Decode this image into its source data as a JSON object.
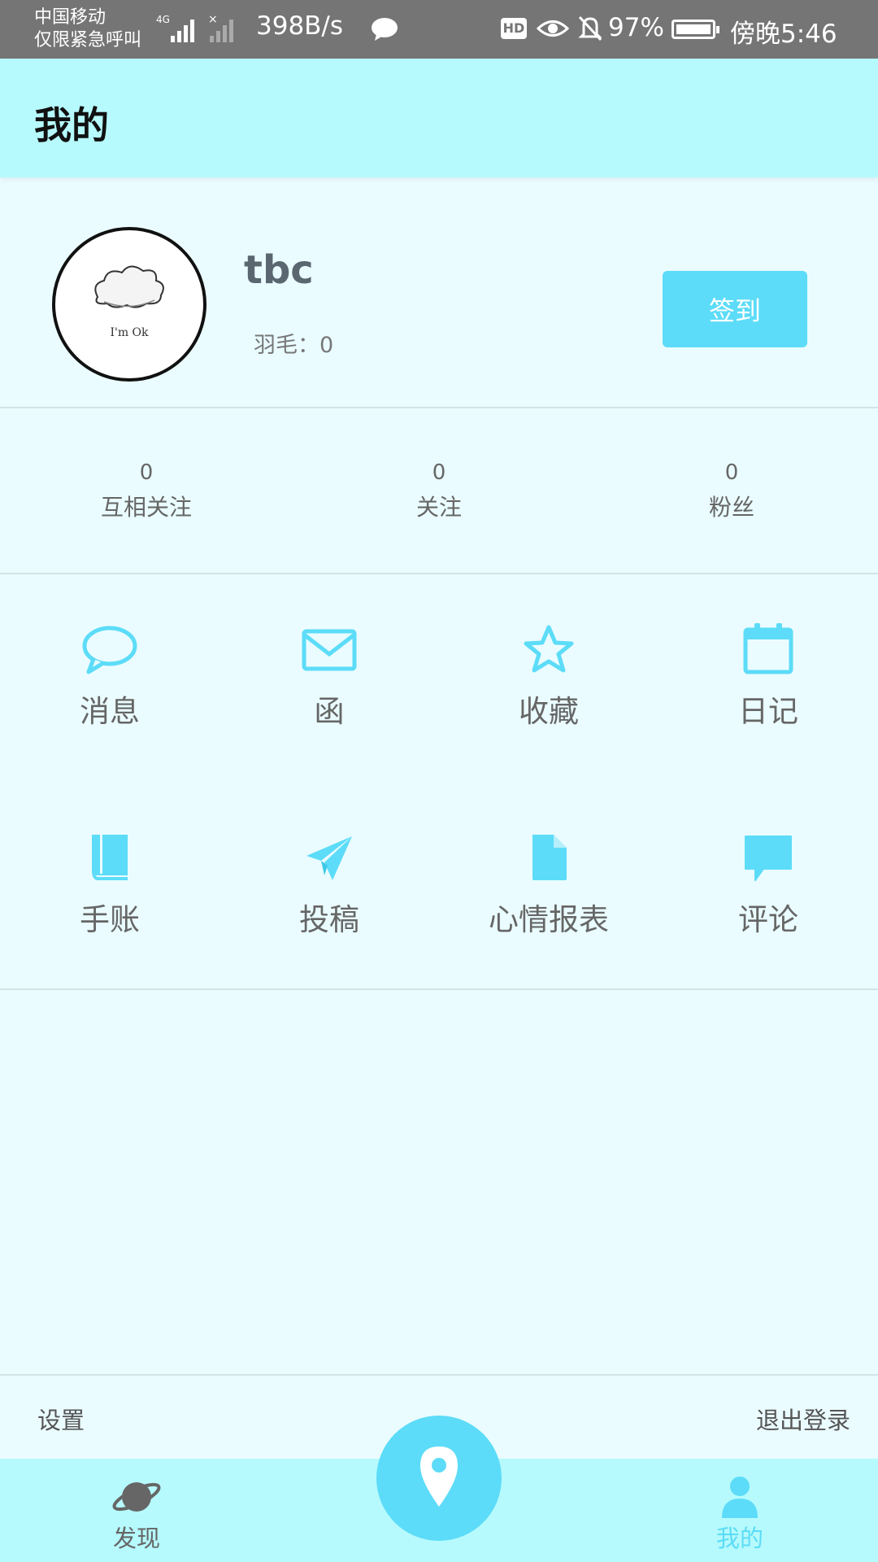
{
  "status_bar": {
    "carrier_line1": "中国移动",
    "carrier_line2": "仅限紧急呼叫",
    "network": "4G",
    "speed": "398B/s",
    "hd": "HD",
    "battery": "97%",
    "time": "傍晚5:46"
  },
  "header": {
    "title": "我的"
  },
  "profile": {
    "avatar_text": "I'm Ok",
    "username": "tbc",
    "feathers": "羽毛：0",
    "signin_label": "签到"
  },
  "stats": [
    {
      "count": "0",
      "label": "互相关注"
    },
    {
      "count": "0",
      "label": "关注"
    },
    {
      "count": "0",
      "label": "粉丝"
    }
  ],
  "menu": [
    {
      "label": "消息",
      "icon": "message-bubble-icon"
    },
    {
      "label": "函",
      "icon": "envelope-icon"
    },
    {
      "label": "收藏",
      "icon": "star-icon"
    },
    {
      "label": "日记",
      "icon": "calendar-icon"
    },
    {
      "label": "手账",
      "icon": "book-icon"
    },
    {
      "label": "投稿",
      "icon": "paper-plane-icon"
    },
    {
      "label": "心情报表",
      "icon": "document-icon"
    },
    {
      "label": "评论",
      "icon": "comment-icon"
    }
  ],
  "footer": {
    "settings": "设置",
    "logout": "退出登录"
  },
  "tabbar": {
    "discover": "发现",
    "mine": "我的",
    "active_color": "#5cdcf8",
    "inactive_color": "#666666"
  },
  "colors": {
    "accent": "#5cdcf8",
    "header_bg": "#b6fafd",
    "page_bg": "#eafcff"
  }
}
